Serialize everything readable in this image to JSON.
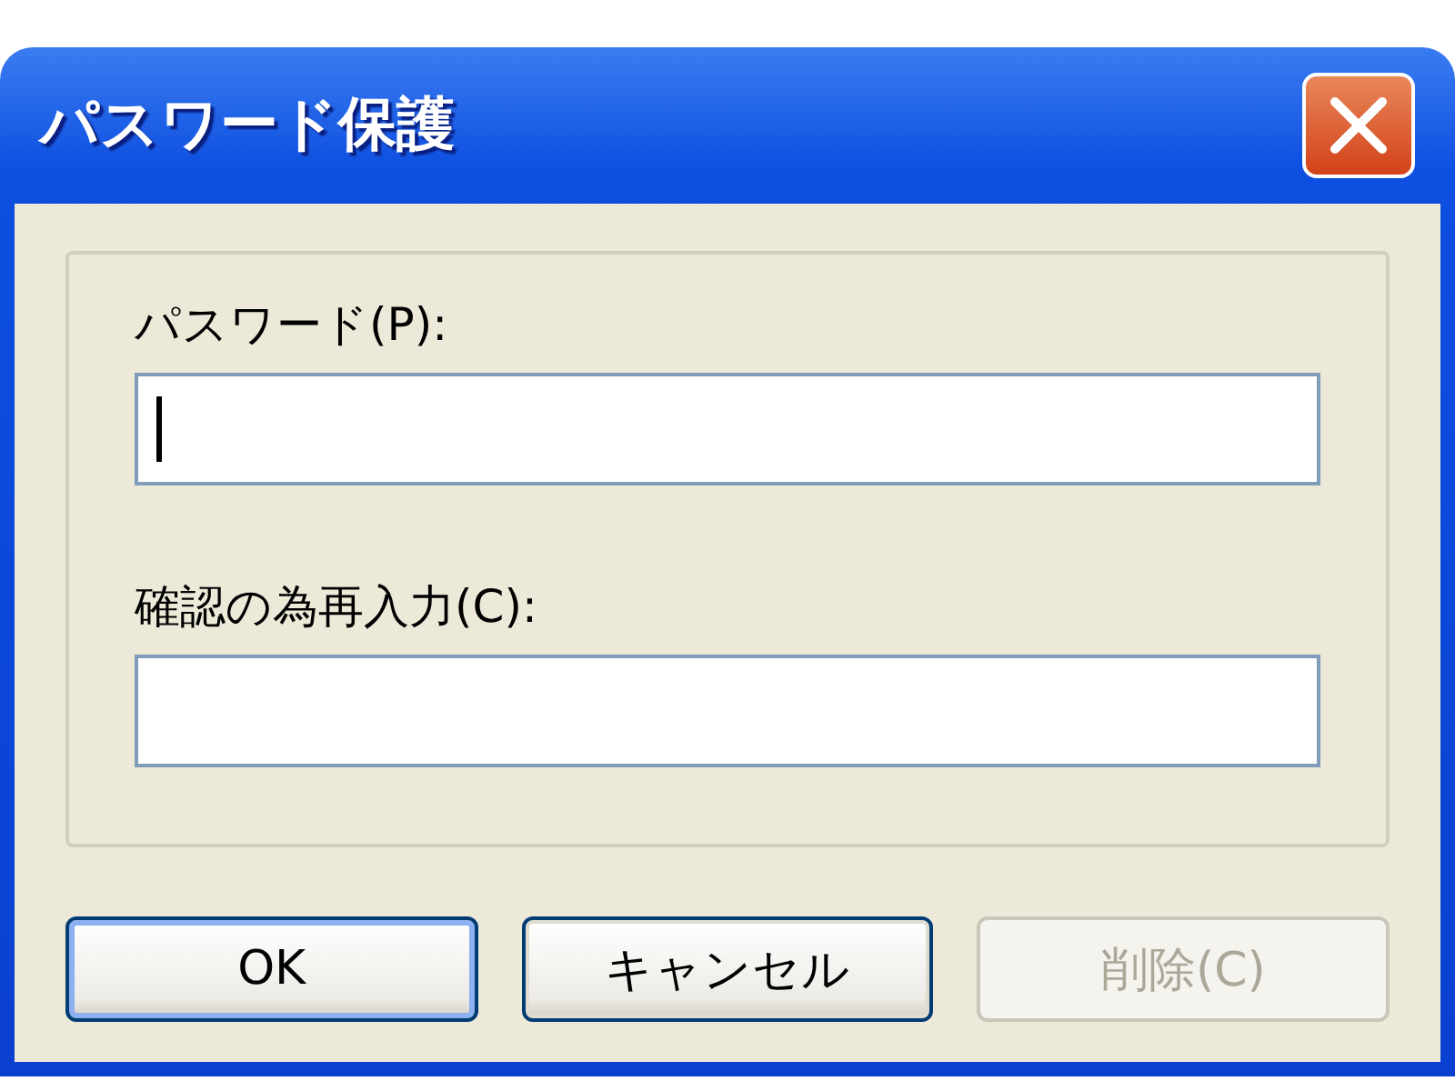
{
  "window": {
    "title": "パスワード保護"
  },
  "fields": [
    {
      "label": "パスワード(P):",
      "focused": true
    },
    {
      "label": "確認の為再入力(C):",
      "focused": false
    }
  ],
  "buttons": [
    {
      "label": "OK",
      "default": true,
      "disabled": false
    },
    {
      "label": "キャンセル",
      "default": false,
      "disabled": false
    },
    {
      "label": "削除(C)",
      "default": false,
      "disabled": true
    }
  ]
}
